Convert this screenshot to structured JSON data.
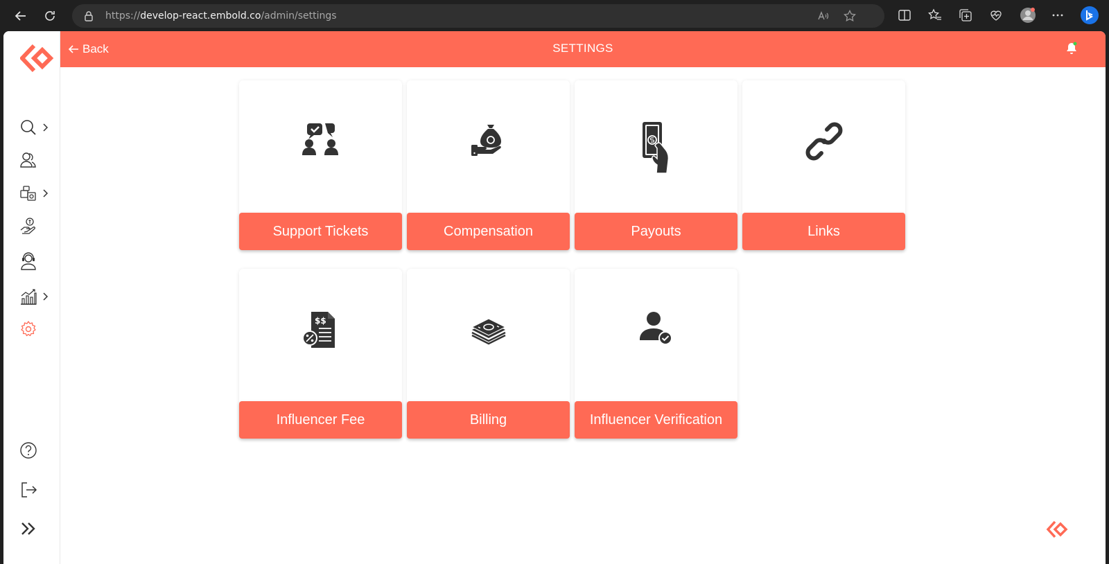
{
  "browser": {
    "url_prefix": "https://",
    "url_host": "develop-react.embold.co",
    "url_path": "/admin/settings"
  },
  "header": {
    "back_label": "Back",
    "title": "SETTINGS"
  },
  "cards": [
    {
      "label": "Support Tickets",
      "icon": "support-tickets-icon"
    },
    {
      "label": "Compensation",
      "icon": "money-bag-hand-icon"
    },
    {
      "label": "Payouts",
      "icon": "payout-hand-icon"
    },
    {
      "label": "Links",
      "icon": "link-icon"
    },
    {
      "label": "Influencer Fee",
      "icon": "invoice-fee-icon"
    },
    {
      "label": "Billing",
      "icon": "cash-stack-icon"
    },
    {
      "label": "Influencer Verification",
      "icon": "user-verified-icon"
    }
  ],
  "colors": {
    "accent": "#ff6a55",
    "icon": "#333333",
    "browser_bg": "#202020"
  }
}
